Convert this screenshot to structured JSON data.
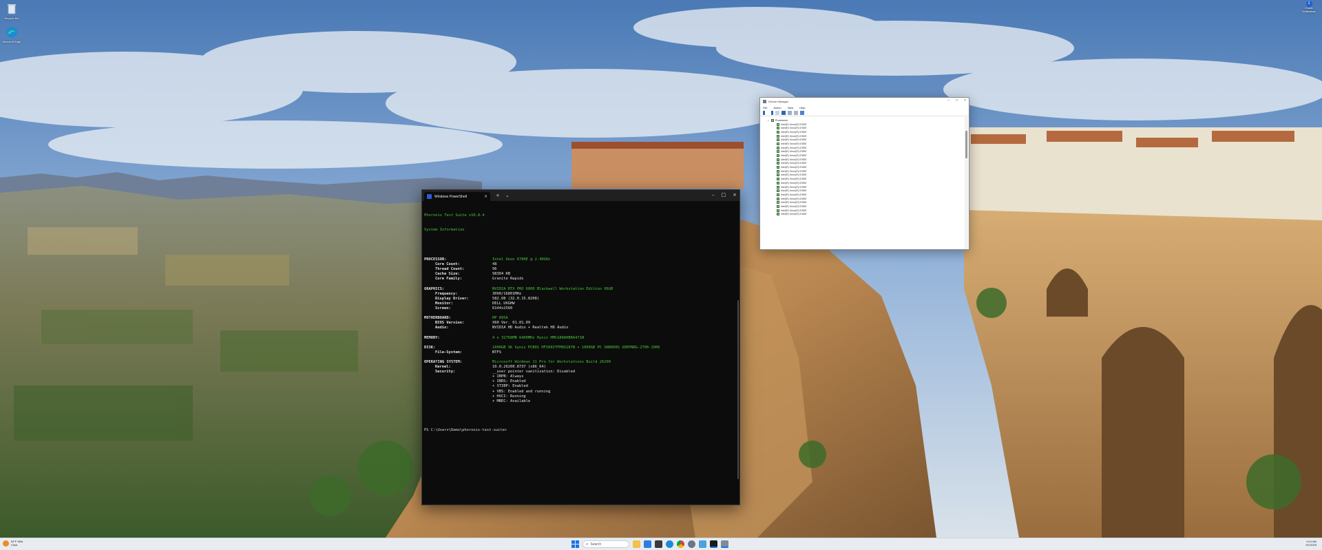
{
  "desktop": {
    "icons": [
      {
        "label": "Recycle Bin",
        "icon": "recycle-bin-icon"
      },
      {
        "label": "Microsoft Edge",
        "icon": "edge-icon"
      }
    ],
    "notification": {
      "badge": "1",
      "line1": "Enable",
      "line2": "Notifications"
    }
  },
  "terminal": {
    "tab_title": "Windows PowerShell",
    "tab_close": "×",
    "new_tab": "+",
    "dropdown": "⌄",
    "controls": {
      "minimize": "–",
      "maximize": "□",
      "close": "×"
    },
    "header_line1": "Phoronix Test Suite v10.8.4",
    "header_line2": "System Information",
    "sections": [
      {
        "rows": [
          {
            "key": "PROCESSOR:",
            "val": "Intel Xeon 6780E @ 2.40GHz",
            "sub": false
          },
          {
            "key": "Core Count:",
            "val": "48",
            "sub": true
          },
          {
            "key": "Thread Count:",
            "val": "96",
            "sub": true
          },
          {
            "key": "Cache Size:",
            "val": "98304 KB",
            "sub": true
          },
          {
            "key": "Core Family:",
            "val": "Granite Rapids",
            "sub": true
          }
        ]
      },
      {
        "rows": [
          {
            "key": "GRAPHICS:",
            "val": "NVIDIA RTX PRO 6000 Blackwell Workstation Edition 96GB",
            "sub": false
          },
          {
            "key": "Frequency:",
            "val": "3090/16801MHz",
            "sub": true
          },
          {
            "key": "Display Driver:",
            "val": "582.08 (32.0.15.8208)",
            "sub": true
          },
          {
            "key": "Monitor:",
            "val": "DELL U6GHW",
            "sub": true
          },
          {
            "key": "Screen:",
            "val": "6144x2560",
            "sub": true
          }
        ]
      },
      {
        "rows": [
          {
            "key": "MOTHERBOARD:",
            "val": "HP 895A",
            "sub": false
          },
          {
            "key": "BIOS Version:",
            "val": "X60 Ver. 01.01.09",
            "sub": true
          },
          {
            "key": "Audio:",
            "val": "NVIDIA HD Audio + Realtek HD Audio",
            "sub": true
          }
        ]
      },
      {
        "rows": [
          {
            "key": "MEMORY:",
            "val": "4 x 32768MB 6400MHz Hynix HMCG88AHBRA471N",
            "sub": false
          }
        ]
      },
      {
        "rows": [
          {
            "key": "DISK:",
            "val": "1000GB SK hynix PCB01 HFS002TFM9X187N + 1000GB PC SN8000S SDEPNRG-2T00-1006",
            "sub": false
          },
          {
            "key": "File-System:",
            "val": "NTFS",
            "sub": true
          }
        ]
      },
      {
        "rows": [
          {
            "key": "OPERATING SYSTEM:",
            "val": "Microsoft Windows 11 Pro for Workstations Build 26200",
            "sub": false
          },
          {
            "key": "Kernel:",
            "val": "10.0.26200.8737 (x86_64)",
            "sub": true
          },
          {
            "key": "Security:",
            "val": "__user pointer sanitization: Disabled",
            "sub": true
          },
          {
            "key": "",
            "val": "+ IBPB: Always",
            "sub": true
          },
          {
            "key": "",
            "val": "+ IBRS: Enabled",
            "sub": true
          },
          {
            "key": "",
            "val": "+ STIBP: Enabled",
            "sub": true
          },
          {
            "key": "",
            "val": "+ VBS: Enabled and running",
            "sub": true
          },
          {
            "key": "",
            "val": "+ HVCI: Running",
            "sub": true
          },
          {
            "key": "",
            "val": "+ MBEC: Available",
            "sub": true
          }
        ]
      }
    ],
    "prompt": "PS C:\\Users\\Demo\\phoronix-test-suite>"
  },
  "device_manager": {
    "title": "Device Manager",
    "controls": {
      "minimize": "–",
      "maximize": "□",
      "close": "×"
    },
    "menu": [
      "File",
      "Action",
      "View",
      "Help"
    ],
    "tree_root": "Processors",
    "items": [
      "Intel(R) Xeon(R) 6780E",
      "Intel(R) Xeon(R) 6780E",
      "Intel(R) Xeon(R) 6780E",
      "Intel(R) Xeon(R) 6780E",
      "Intel(R) Xeon(R) 6780E",
      "Intel(R) Xeon(R) 6780E",
      "Intel(R) Xeon(R) 6780E",
      "Intel(R) Xeon(R) 6780E",
      "Intel(R) Xeon(R) 6780E",
      "Intel(R) Xeon(R) 6780E",
      "Intel(R) Xeon(R) 6780E",
      "Intel(R) Xeon(R) 6780E",
      "Intel(R) Xeon(R) 6780E",
      "Intel(R) Xeon(R) 6780E",
      "Intel(R) Xeon(R) 6780E",
      "Intel(R) Xeon(R) 6780E",
      "Intel(R) Xeon(R) 6780E",
      "Intel(R) Xeon(R) 6780E",
      "Intel(R) Xeon(R) 6780E",
      "Intel(R) Xeon(R) 6780E",
      "Intel(R) Xeon(R) 6780E",
      "Intel(R) Xeon(R) 6780E",
      "Intel(R) Xeon(R) 6780E",
      "Intel(R) Xeon(R) 6780E"
    ]
  },
  "taskbar": {
    "weather_temp": "54°F Mild",
    "weather_desc": "Clear",
    "search_placeholder": "Search",
    "time": "9:14 AM",
    "date": "9/1/2025",
    "pinned": [
      "file-explorer-icon",
      "mail-icon",
      "store-icon",
      "edge-icon",
      "chrome-icon",
      "settings-icon",
      "photos-icon",
      "terminal-icon",
      "device-manager-icon"
    ]
  },
  "colors": {
    "terminal_bg": "#0c0c0c",
    "terminal_green": "#46c93a",
    "taskbar_bg": "#e8ecf1",
    "windows_blue": "#1a73e8"
  }
}
